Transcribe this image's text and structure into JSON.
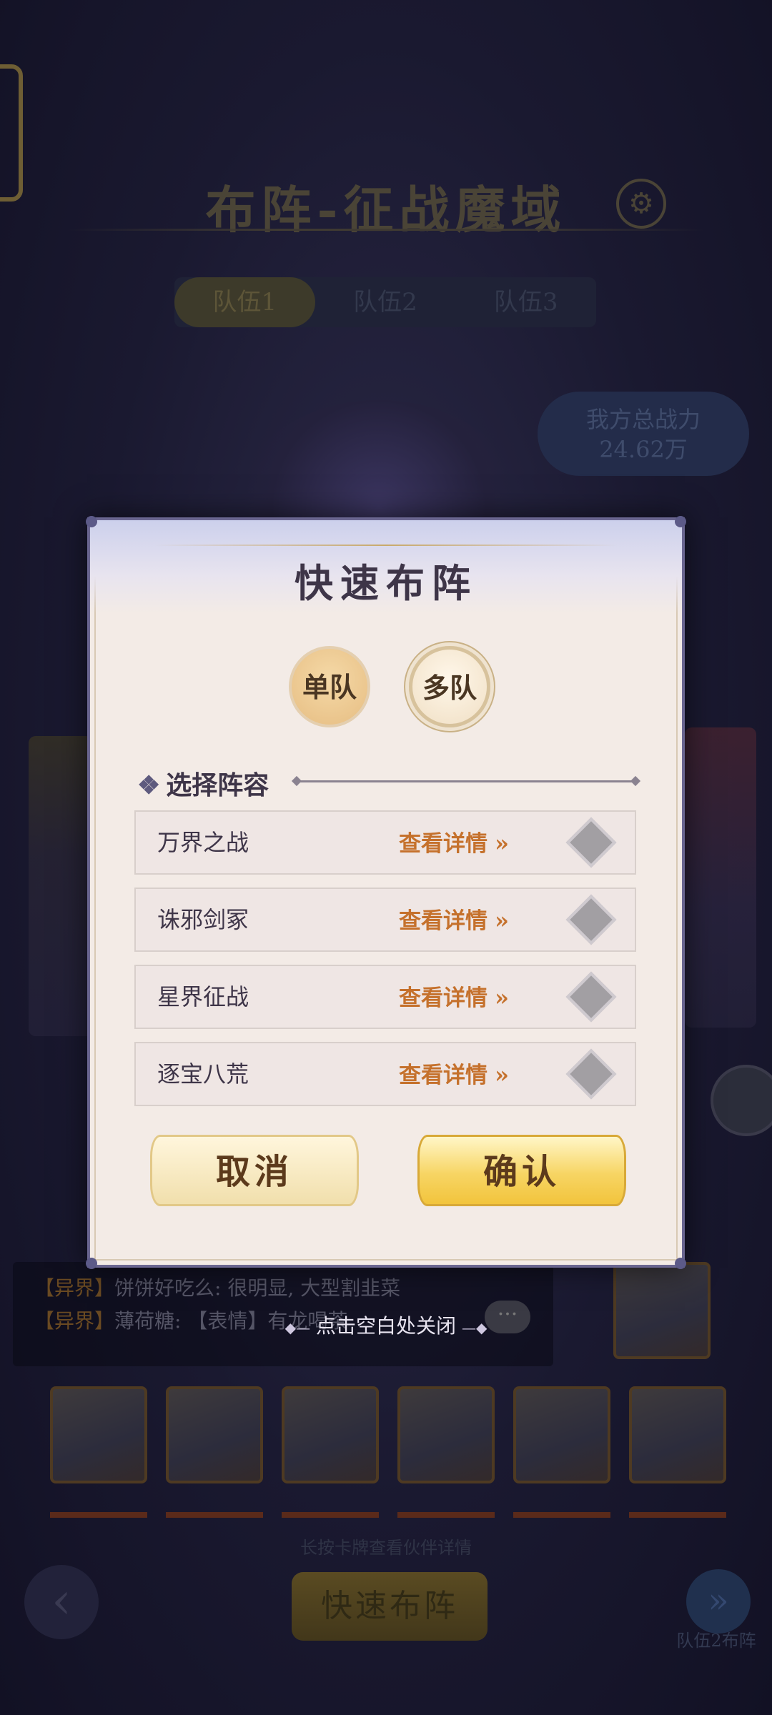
{
  "background": {
    "title": "布阵-征战魔域",
    "tabs": [
      "队伍1",
      "队伍2",
      "队伍3"
    ],
    "power_label": "我方总战力",
    "power_value": "24.62万",
    "chat": [
      {
        "tag": "【异界】",
        "text": "饼饼好吃么: 很明显, 大型割韭菜"
      },
      {
        "tag": "【异界】",
        "text": "薄荷糖: 【表情】有龙喝茶"
      }
    ],
    "hint": "长按卡牌查看伙伴详情",
    "quick_button": "快速布阵",
    "next_label": "队伍2布阵"
  },
  "modal": {
    "title": "快速布阵",
    "mode_single": "单队",
    "mode_multi": "多队",
    "section_title": "选择阵容",
    "view_details": "查看详情",
    "rows": [
      {
        "name": "万界之战"
      },
      {
        "name": "诛邪剑冢"
      },
      {
        "name": "星界征战"
      },
      {
        "name": "逐宝八荒"
      }
    ],
    "cancel": "取消",
    "confirm": "确认"
  },
  "close_hint": "点击空白处关闭",
  "colors": {
    "modal_bg": "#f3ebe6",
    "link": "#c5712c",
    "confirm_gold": "#f7d564"
  }
}
